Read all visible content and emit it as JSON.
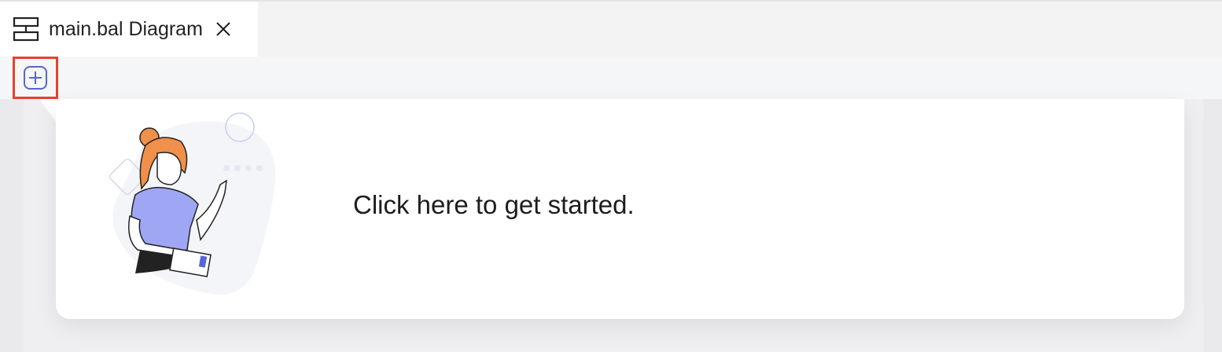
{
  "tab": {
    "label": "main.bal Diagram",
    "icon": "diagram-icon",
    "close_icon": "close-icon"
  },
  "toolbar": {
    "add_icon": "add-icon"
  },
  "main": {
    "cta_text": "Click here to get started.",
    "illustration": "person-pointing-illustration"
  },
  "colors": {
    "accent": "#5566d6",
    "highlight": "#e8402f",
    "shirt": "#9fa7f5",
    "hair": "#f0904a"
  }
}
